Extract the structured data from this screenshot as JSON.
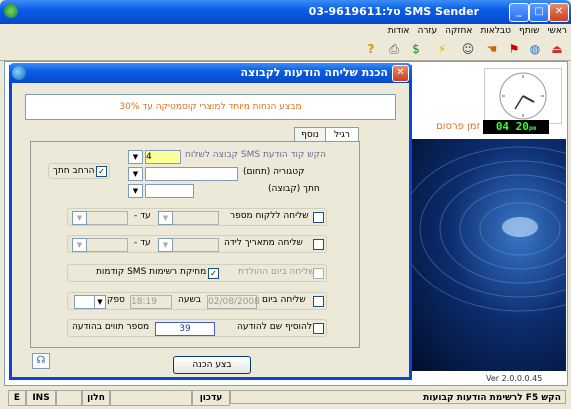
{
  "window": {
    "title": "SMS Sender  טל:03-9619611"
  },
  "menu": [
    "ראשי",
    "שותף",
    "טבלאות",
    "אחזקה",
    "עזרה",
    "אודות"
  ],
  "toolbar_icons": [
    "exit-icon",
    "globe-icon",
    "flag-icon",
    "hand-icon",
    "users-icon",
    "lightning-icon",
    "money-icon",
    "printer-icon",
    "help-icon"
  ],
  "dialog": {
    "title": "הכנת שליחה הודעות לקבוצה",
    "notice": "מבצע הנחות מיוחד למוצרי קוסמטיקה עד 30%",
    "tabs": {
      "general": "רגיל",
      "extra": "נוסף"
    },
    "group_code_label": "הקש קוד הודעת SMS קבוצה לשלוח",
    "group_code_value": "4",
    "category_label": "קטגוריה (תחום)",
    "category_value": "",
    "group_sub_label": "חתך (קבוצה)",
    "expand_subgroup_label": "הרחב חתך",
    "expand_subgroup_checked": true,
    "send_by_number_label": "שליחה ללקוח מספר",
    "send_by_birthdate_label": "שליחה מתאריך לידה",
    "to_label": "עד -",
    "send_today_label": "שליחה ביום ההולדת",
    "delete_prev_lists_label": "מחיקת רשימות SMS קודמות",
    "delete_prev_lists_checked": true,
    "send_on_day_label": "שליחה ביום",
    "send_date_value": "02/08/2008",
    "at_hour_label": "בשעה",
    "send_time_value": "18:19",
    "speed_label": "ספק",
    "add_name_label": "להוסיף שם להודעה",
    "chars_value": "39",
    "chars_label": "מספר תווים בהודעה",
    "execute_label": "בצע הכנה"
  },
  "right_panel": {
    "ad_label": "זמן פרסום",
    "clock_time": "04 20",
    "clock_suffix": "pm",
    "version": "Ver 2.0.0.0.45"
  },
  "statusbar": {
    "e": "E",
    "ins": "INS",
    "window": "חלון",
    "update": "עדכון",
    "hint": "הקש F5 לרשימת הודעות קבועות"
  }
}
